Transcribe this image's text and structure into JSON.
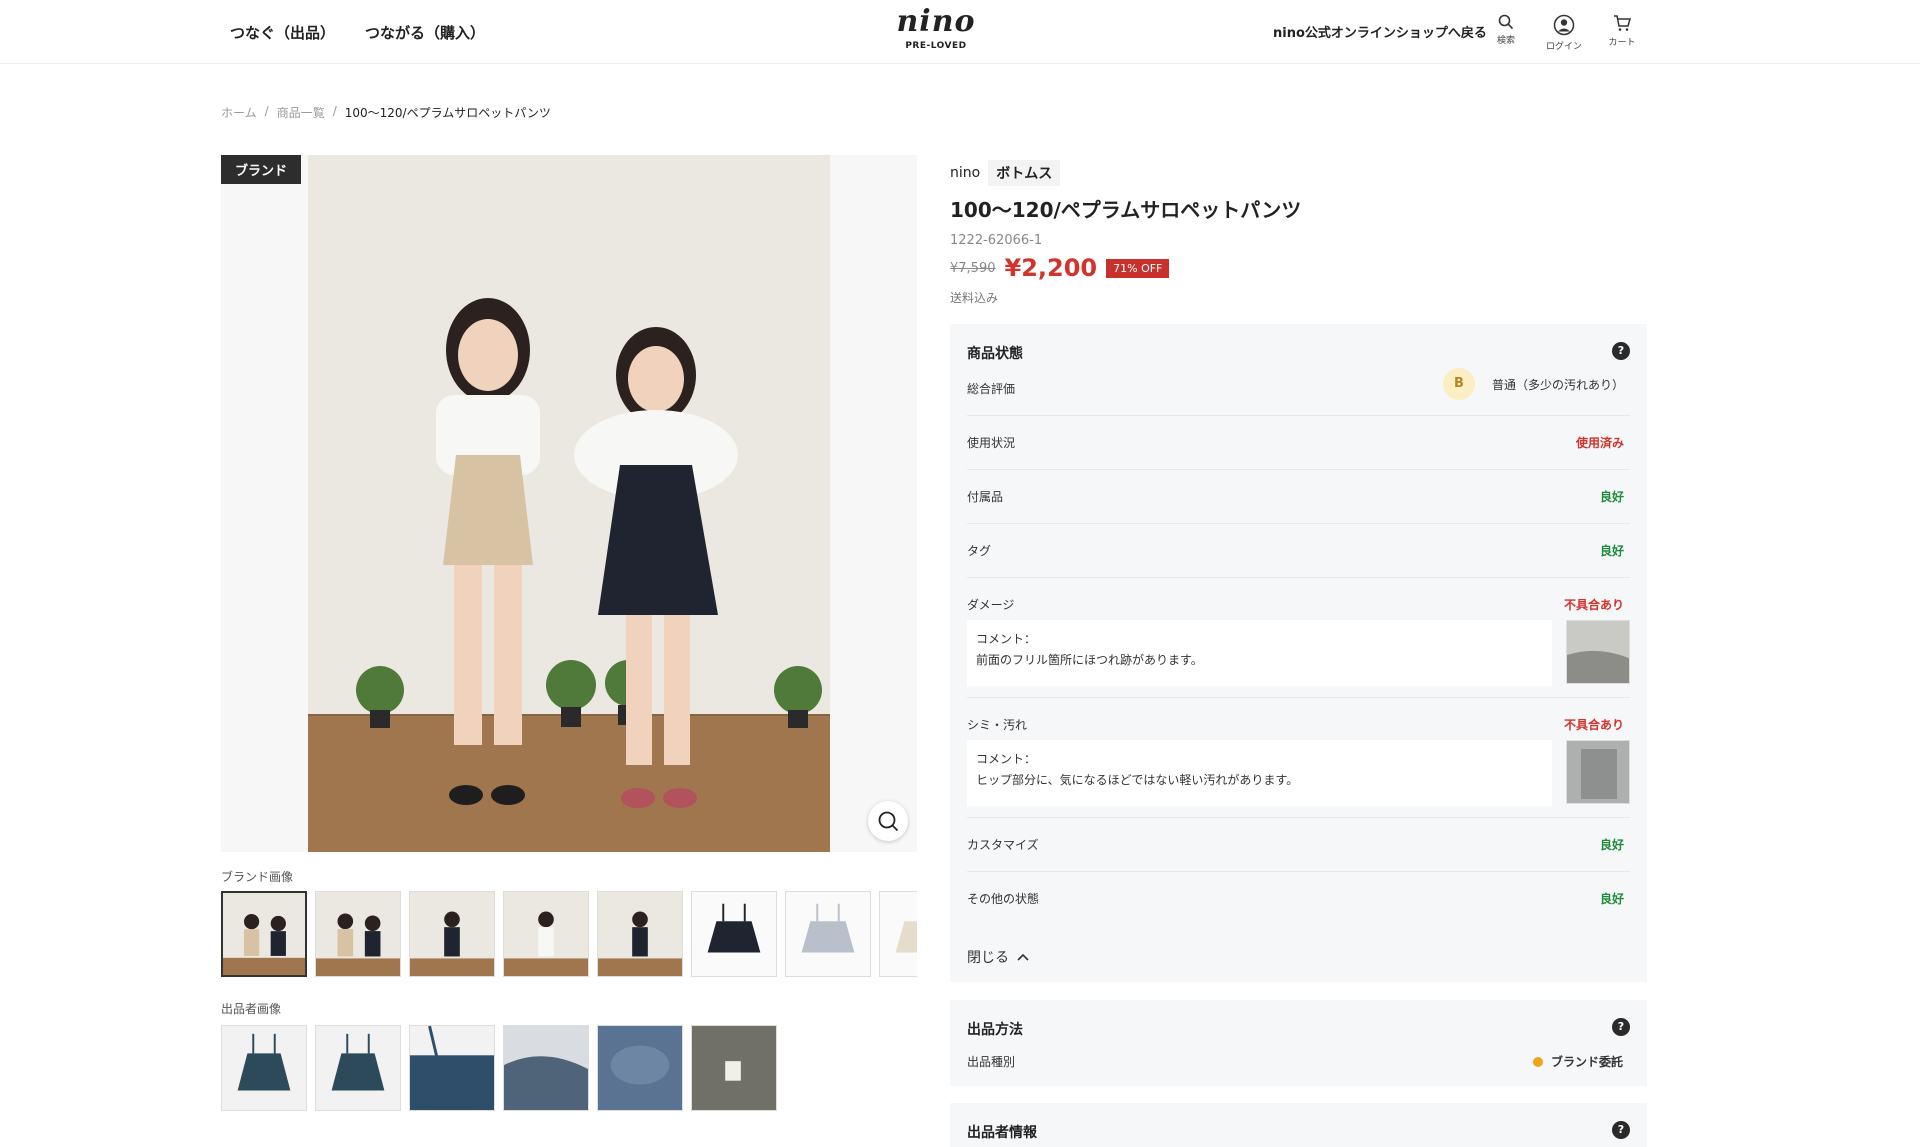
{
  "header": {
    "nav": [
      "つなぐ（出品）",
      "つながる（購入）"
    ],
    "logo_text": "nino",
    "logo_sub": "PRE-LOVED",
    "back_link": "nino公式オンラインショップへ戻る",
    "icons": [
      {
        "name": "search-icon",
        "label": "検索"
      },
      {
        "name": "user-icon",
        "label": "ログイン"
      },
      {
        "name": "cart-icon",
        "label": "カート"
      }
    ]
  },
  "breadcrumb": {
    "home": "ホーム",
    "list": "商品一覧",
    "sep": "/",
    "current": "100〜120/ペプラムサロペットパンツ"
  },
  "gallery": {
    "brand_tag": "ブランド",
    "brand_images_label": "ブランド画像",
    "seller_images_label": "出品者画像"
  },
  "product": {
    "brand": "nino",
    "category": "ボトムス",
    "title": "100〜120/ペプラムサロペットパンツ",
    "sku": "1222-62066-1",
    "original_price": "¥7,590",
    "price": "¥2,200",
    "discount": "71% OFF",
    "shipping": "送料込み"
  },
  "condition": {
    "title": "商品状態",
    "help": "?",
    "overall_label": "総合評価",
    "overall_grade": "B",
    "overall_text": "普通（多少の汚れあり）",
    "rows": [
      {
        "label": "使用状況",
        "value": "使用済み",
        "status": "bad"
      },
      {
        "label": "付属品",
        "value": "良好",
        "status": "good"
      },
      {
        "label": "タグ",
        "value": "良好",
        "status": "good"
      },
      {
        "label": "ダメージ",
        "value": "不具合あり",
        "status": "bad"
      },
      {
        "label": "シミ・汚れ",
        "value": "不具合あり",
        "status": "bad"
      },
      {
        "label": "カスタマイズ",
        "value": "良好",
        "status": "good"
      },
      {
        "label": "その他の状態",
        "value": "良好",
        "status": "good"
      }
    ],
    "damage_comment_label": "コメント：",
    "damage_comment": "前面のフリル箇所にほつれ跡があります。",
    "stain_comment_label": "コメント：",
    "stain_comment": "ヒップ部分に、気になるほどではない軽い汚れがあります。",
    "close_label": "閉じる"
  },
  "method": {
    "title": "出品方法",
    "help": "?",
    "type_label": "出品種別",
    "type_value": "ブランド委託"
  },
  "seller": {
    "title": "出品者情報",
    "help": "?"
  },
  "colors": {
    "price_red": "#d2332c",
    "good_green": "#1e8a3a",
    "panel_bg": "#f5f7f9",
    "grade_bg": "#fbeec2",
    "dot_orange": "#f0a41b"
  }
}
